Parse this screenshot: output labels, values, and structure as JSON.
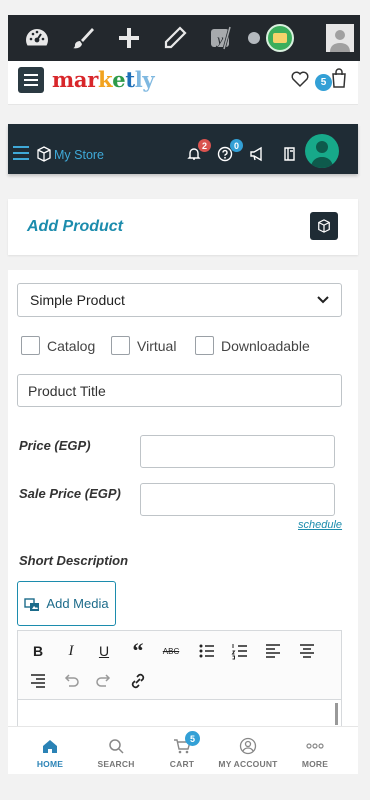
{
  "admin_bar": {
    "icons": [
      "dashboard-icon",
      "brush-icon",
      "plus-icon",
      "pencil-icon",
      "yoast-icon",
      "status-dot-icon",
      "site-avatar-icon",
      "user-avatar-icon"
    ],
    "yoast_letter": "y"
  },
  "site_header": {
    "logo_parts": [
      {
        "text": "mar",
        "color": "#d8262a"
      },
      {
        "text": "k",
        "color": "#f2a31f"
      },
      {
        "text": "e",
        "color": "#2d9a49"
      },
      {
        "text": "t",
        "color": "#1e6fb8"
      },
      {
        "text": "ly",
        "color": "#7fb8e0"
      }
    ],
    "cart_count": "5"
  },
  "store_bar": {
    "label": "My Store",
    "notifications_count": "2",
    "help_count": "0",
    "colors": {
      "accent": "#3fa9d8",
      "notif_badge": "#d9534f",
      "help_badge": "#33a0d6"
    }
  },
  "page": {
    "title": "Add Product"
  },
  "form": {
    "product_type": "Simple Product",
    "options": [
      "Catalog",
      "Virtual",
      "Downloadable"
    ],
    "title_placeholder": "Product Title",
    "price_label": "Price (EGP)",
    "sale_price_label": "Sale Price (EGP)",
    "schedule_link": "schedule",
    "short_desc_label": "Short Description",
    "add_media": "Add Media",
    "toolbar_row1": [
      "bold-icon",
      "italic-icon",
      "underline-icon",
      "blockquote-icon",
      "strikethrough-icon",
      "bullet-list-icon",
      "numbered-list-icon",
      "align-left-icon",
      "align-center-icon"
    ],
    "toolbar_row2": [
      "align-right-icon",
      "undo-icon",
      "redo-icon",
      "link-icon"
    ],
    "toolbar_text": {
      "bold": "B",
      "italic": "I",
      "underline": "U",
      "quote": "“",
      "strike": "ABC"
    }
  },
  "bottom_nav": {
    "items": [
      {
        "label": "HOME",
        "icon": "home-icon",
        "active": true
      },
      {
        "label": "SEARCH",
        "icon": "search-icon"
      },
      {
        "label": "CART",
        "icon": "cart-icon"
      },
      {
        "label": "MY ACCOUNT",
        "icon": "account-icon"
      },
      {
        "label": "MORE",
        "icon": "more-icon"
      }
    ],
    "cart_count": "5"
  }
}
